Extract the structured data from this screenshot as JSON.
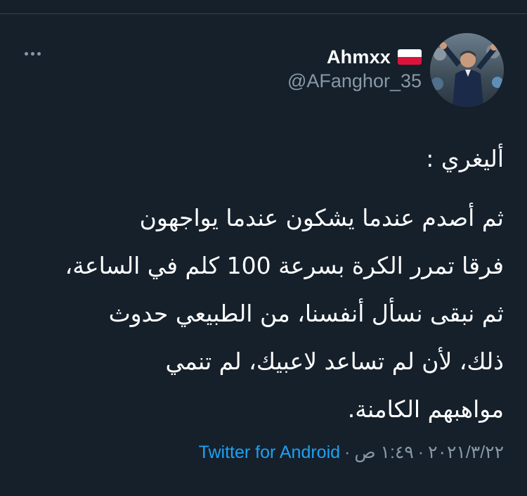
{
  "header": {
    "display_name": "Ahmxx",
    "handle": "@AFanghor_35",
    "flag_icon": "poland-flag-icon"
  },
  "tweet": {
    "lines": [
      "أليغري :",
      "ثم أصدم عندما يشكون عندما يواجهون",
      "فرقا تمرر الكرة بسرعة 100 كلم في الساعة،",
      "ثم نبقى نسأل أنفسنا، من الطبيعي حدوث",
      "ذلك، لأن لم تساعد لاعبيك، لم تنمي",
      "مواهبهم الكامنة."
    ]
  },
  "meta": {
    "source": "Twitter for Android",
    "separator": "·",
    "time": "١:٤٩ ص",
    "date": "٢٠٢١/٣/٢٢"
  },
  "colors": {
    "background": "#15202b",
    "secondary_text": "#8899a6",
    "link": "#1da1f2"
  }
}
